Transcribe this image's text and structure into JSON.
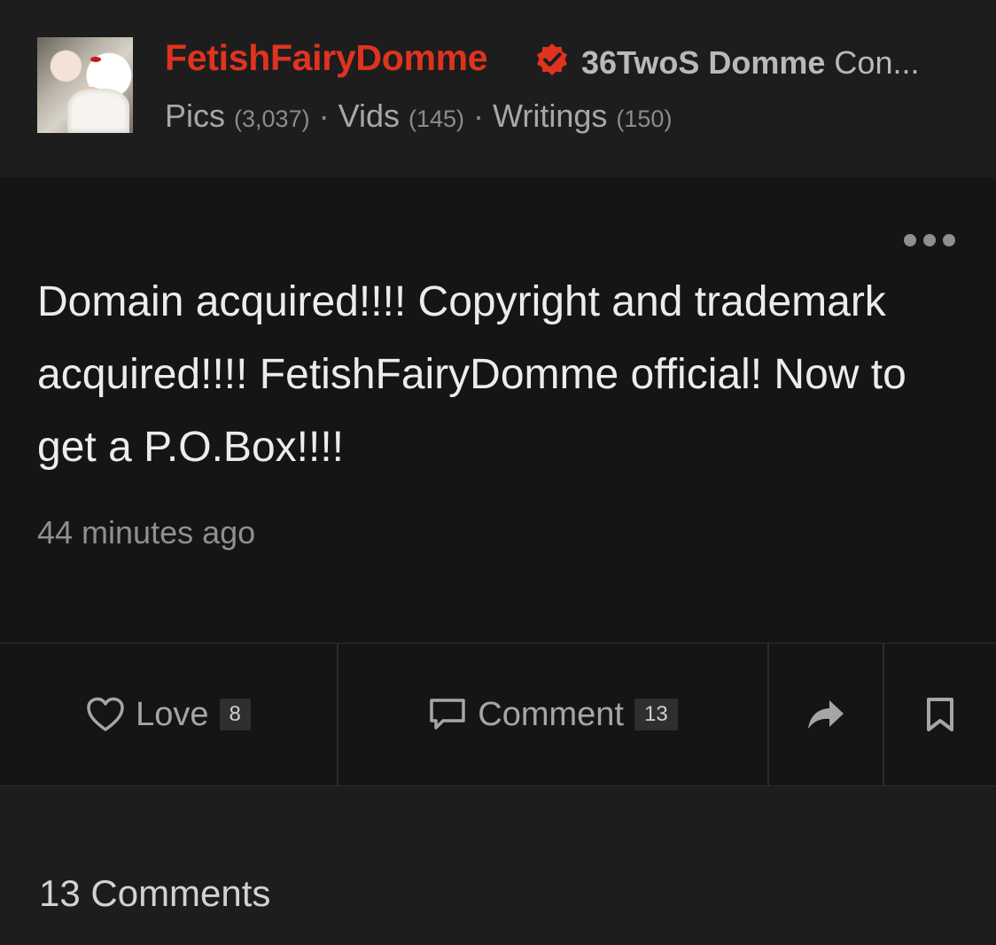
{
  "profile": {
    "username": "FetishFairyDomme",
    "subtitle_bold": "36TwoS Domme",
    "subtitle_rest": "Con...",
    "stats": [
      {
        "label": "Pics",
        "count": "(3,037)"
      },
      {
        "label": "Vids",
        "count": "(145)"
      },
      {
        "label": "Writings",
        "count": "(150)"
      }
    ]
  },
  "post": {
    "text": "Domain acquired!!!! Copyright and trademark acquired!!!! FetishFairyDomme official! Now to get a P.O.Box!!!!",
    "timestamp": "44 minutes ago"
  },
  "actions": {
    "love_label": "Love",
    "love_count": "8",
    "comment_label": "Comment",
    "comment_count": "13"
  },
  "comments": {
    "heading": "13 Comments"
  },
  "colors": {
    "accent": "#e0331f",
    "background": "#1d1d1d",
    "post_background": "#151515"
  },
  "icons": [
    "verified-badge-icon",
    "more-options-icon",
    "heart-icon",
    "comment-icon",
    "share-arrow-icon",
    "bookmark-icon"
  ]
}
